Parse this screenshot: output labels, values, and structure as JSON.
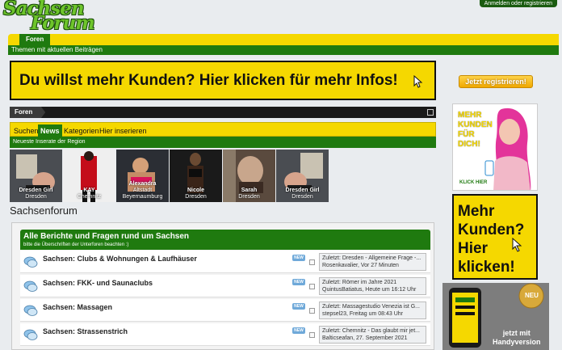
{
  "header": {
    "logo_line1": "Sachsen",
    "logo_line2": "Forum",
    "login": "Anmelden oder registrieren"
  },
  "nav": {
    "tab": "Foren",
    "subtab": "Themen mit aktuellen Beiträgen"
  },
  "banner": {
    "text": "Du willst mehr Kunden? Hier klicken für mehr Infos!"
  },
  "breadcrumb": {
    "item": "Foren"
  },
  "ads": {
    "tabs": [
      "Suchen",
      "News",
      "Kategorien",
      "Hier inserieren"
    ],
    "active_tab": "News",
    "subtitle": "Neueste Inserate der Region",
    "thumbs": [
      {
        "name": "Dresden Girl",
        "city": "Dresden"
      },
      {
        "name": "KAY",
        "city": "Chemnitz"
      },
      {
        "name": "Alexandra",
        "city": "Altstadt Beyernaumburg"
      },
      {
        "name": "Nicole",
        "city": "Dresden"
      },
      {
        "name": "Sarah",
        "city": "Dresden"
      },
      {
        "name": "Dresden Girl",
        "city": "Dresden"
      }
    ]
  },
  "page_title": "Sachsenforum",
  "forum": {
    "header_title": "Alle Berichte und Fragen rund um Sachsen",
    "header_sub": "bitte die Überschriften der Unterforen beachten :)",
    "rows": [
      {
        "title": "Sachsen: Clubs & Wohnungen & Laufhäuser",
        "badge": "NEW",
        "last_line1": "Zuletzt: Dresden - Allgemeine Frage -...",
        "last_line2": "Rosenkavalier, Vor 27 Minuten"
      },
      {
        "title": "Sachsen: FKK- und Saunaclubs",
        "badge": "NEW",
        "last_line1": "Zuletzt: Römer im Jahre 2021",
        "last_line2": "QuintusBatiatus, Heute um 16:12 Uhr"
      },
      {
        "title": "Sachsen: Massagen",
        "badge": "NEW",
        "last_line1": "Zuletzt: Massagestudio Venezia ist G...",
        "last_line2": "stepsel23, Freitag um 08:43 Uhr"
      },
      {
        "title": "Sachsen: Strassenstrich",
        "badge": "NEW",
        "last_line1": "Zuletzt: Chemnitz - Das glaubt mir jet...",
        "last_line2": "Balticseafan, 27. September 2021"
      }
    ]
  },
  "sidebar": {
    "join_button": "Jetzt registrieren!",
    "ad1_title": "MEHR KUNDEN FÜR DICH!",
    "ad1_line1": "MEHR",
    "ad1_line2": "KUNDEN",
    "ad1_line3": "FÜR",
    "ad1_line4": "DICH!",
    "ad1_cta": "KLICK HIER",
    "ad2_line1": "Mehr",
    "ad2_line2": "Kunden?",
    "ad2_line3": "Hier",
    "ad2_line4": "klicken!",
    "ad3_line1": "jetzt mit",
    "ad3_line2": "Handyversion",
    "ad3_badge": "NEU"
  },
  "colors": {
    "green": "#1f7a0f",
    "yellow": "#f5d800",
    "badge_blue": "#6fa9d9"
  }
}
